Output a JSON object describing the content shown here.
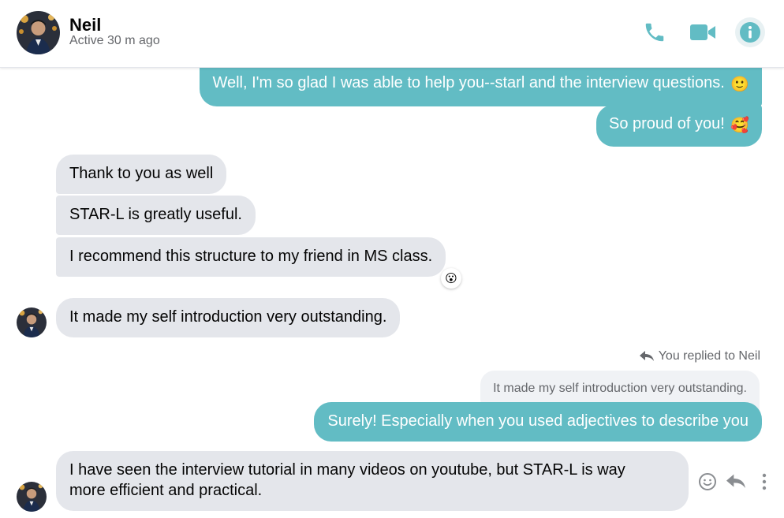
{
  "contact": {
    "name": "Neil",
    "status": "Active 30 m ago"
  },
  "header_actions": {
    "call_icon": "phone-icon",
    "video_icon": "video-camera-icon",
    "info_icon": "info-icon"
  },
  "colors": {
    "accent": "#62bcc4",
    "incoming_bubble": "#e4e6eb",
    "secondary_text": "#65676b"
  },
  "messages": [
    {
      "direction": "outgoing",
      "text": "Well, I'm so glad I was able to help you--starl and the interview questions.",
      "emoji": "🙂"
    },
    {
      "direction": "outgoing",
      "text": "So proud of you!",
      "emoji": "🥰"
    },
    {
      "direction": "incoming",
      "text": "Thank to you as well"
    },
    {
      "direction": "incoming",
      "text": "STAR-L is greatly useful."
    },
    {
      "direction": "incoming",
      "text": "I recommend this structure to my friend in MS class.",
      "reaction": "😮"
    },
    {
      "direction": "incoming",
      "text": "It made my self introduction very outstanding."
    },
    {
      "direction": "outgoing",
      "reply_note": "You replied to Neil",
      "quoted_text": "It made my self introduction very outstanding.",
      "text": "Surely! Especially when you used adjectives to describe you"
    },
    {
      "direction": "incoming",
      "text_line1": "I have seen the interview tutorial in many videos on youtube, but STAR-L is way",
      "text_line2": "more efficient and practical."
    }
  ],
  "message_actions": [
    "react-icon",
    "reply-icon",
    "more-options-icon"
  ]
}
